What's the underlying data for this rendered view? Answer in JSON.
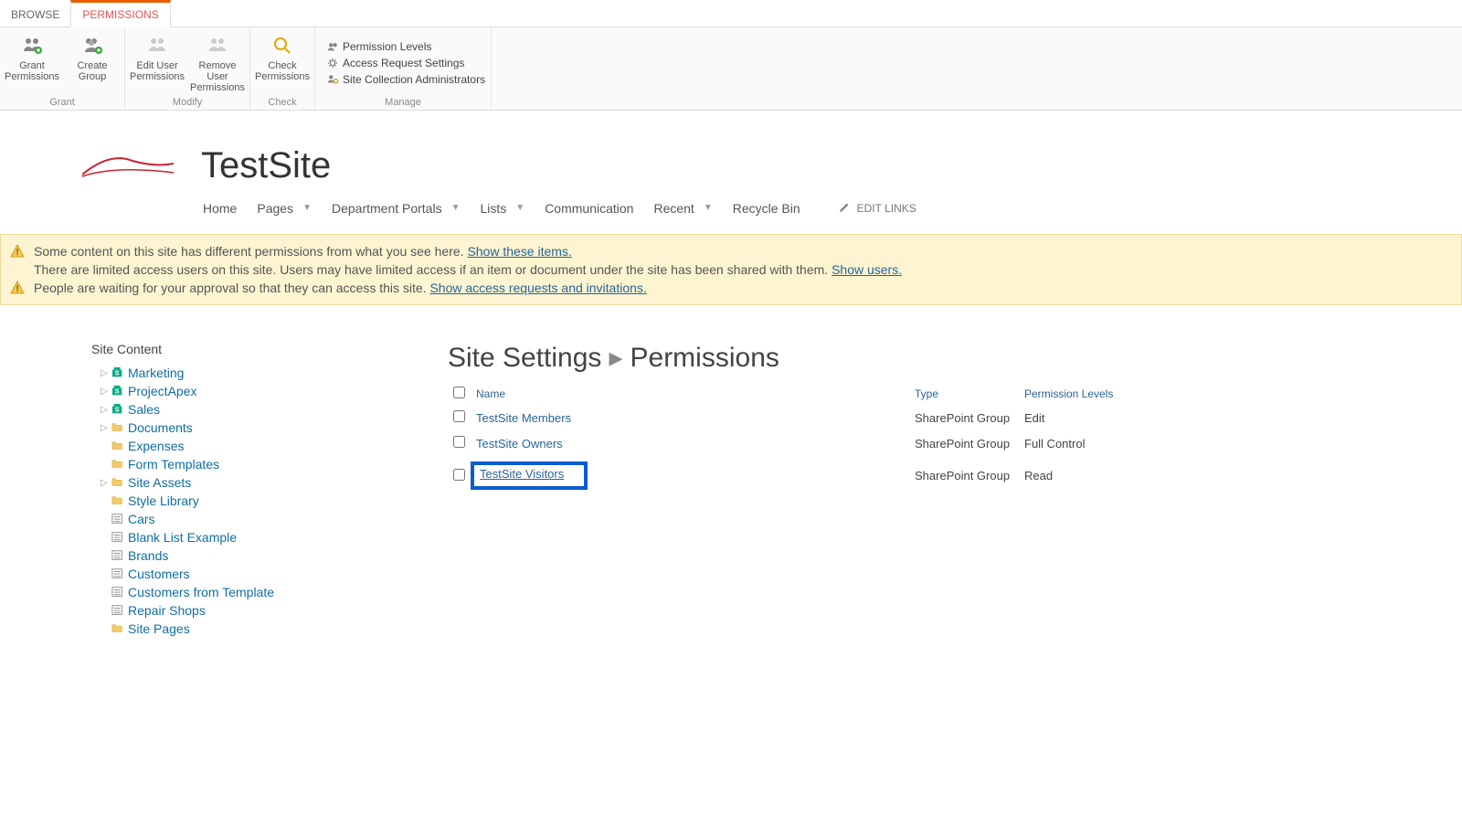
{
  "tabs": {
    "browse": "BROWSE",
    "permissions": "PERMISSIONS"
  },
  "ribbon": {
    "grant": {
      "label": "Grant",
      "buttons": [
        {
          "l1": "Grant",
          "l2": "Permissions",
          "icon": "users-plus"
        },
        {
          "l1": "Create",
          "l2": "Group",
          "icon": "group-plus"
        }
      ]
    },
    "modify": {
      "label": "Modify",
      "buttons": [
        {
          "l1": "Edit User",
          "l2": "Permissions",
          "icon": "users-gray"
        },
        {
          "l1": "Remove User",
          "l2": "Permissions",
          "icon": "users-gray"
        }
      ]
    },
    "check": {
      "label": "Check",
      "buttons": [
        {
          "l1": "Check",
          "l2": "Permissions",
          "icon": "search"
        }
      ]
    },
    "manage": {
      "label": "Manage",
      "links": [
        {
          "text": "Permission Levels",
          "icon": "people-small"
        },
        {
          "text": "Access Request Settings",
          "icon": "gear-small"
        },
        {
          "text": "Site Collection Administrators",
          "icon": "admin-small"
        }
      ]
    }
  },
  "site": {
    "title": "TestSite",
    "nav": [
      {
        "label": "Home",
        "dropdown": false
      },
      {
        "label": "Pages",
        "dropdown": true
      },
      {
        "label": "Department Portals",
        "dropdown": true
      },
      {
        "label": "Lists",
        "dropdown": true
      },
      {
        "label": "Communication",
        "dropdown": false
      },
      {
        "label": "Recent",
        "dropdown": true
      },
      {
        "label": "Recycle Bin",
        "dropdown": false
      }
    ],
    "edit_links": "EDIT LINKS"
  },
  "notifications": [
    {
      "icon": true,
      "text": "Some content on this site has different permissions from what you see here.",
      "link": "Show these items."
    },
    {
      "icon": false,
      "text": "There are limited access users on this site. Users may have limited access if an item or document under the site has been shared with them.",
      "link": "Show users."
    },
    {
      "icon": true,
      "text": "People are waiting for your approval so that they can access this site.",
      "link": "Show access requests and invitations."
    }
  ],
  "sidebar": {
    "title": "Site Content",
    "items": [
      {
        "label": "Marketing",
        "icon": "site",
        "exp": true
      },
      {
        "label": "ProjectApex",
        "icon": "site",
        "exp": true
      },
      {
        "label": "Sales",
        "icon": "site",
        "exp": true
      },
      {
        "label": "Documents",
        "icon": "folder",
        "exp": true
      },
      {
        "label": "Expenses",
        "icon": "folder",
        "exp": false
      },
      {
        "label": "Form Templates",
        "icon": "folder",
        "exp": false
      },
      {
        "label": "Site Assets",
        "icon": "folder",
        "exp": true
      },
      {
        "label": "Style Library",
        "icon": "folder",
        "exp": false
      },
      {
        "label": "Cars",
        "icon": "list",
        "exp": false
      },
      {
        "label": "Blank List Example",
        "icon": "list",
        "exp": false
      },
      {
        "label": "Brands",
        "icon": "list",
        "exp": false
      },
      {
        "label": "Customers",
        "icon": "list",
        "exp": false
      },
      {
        "label": "Customers from Template",
        "icon": "list",
        "exp": false
      },
      {
        "label": "Repair Shops",
        "icon": "list",
        "exp": false
      },
      {
        "label": "Site Pages",
        "icon": "folder",
        "exp": false
      }
    ]
  },
  "content": {
    "breadcrumb_a": "Site Settings",
    "breadcrumb_b": "Permissions",
    "columns": {
      "name": "Name",
      "type": "Type",
      "perm": "Permission Levels"
    },
    "rows": [
      {
        "name": "TestSite Members",
        "type": "SharePoint Group",
        "perm": "Edit",
        "highlight": false
      },
      {
        "name": "TestSite Owners",
        "type": "SharePoint Group",
        "perm": "Full Control",
        "highlight": false
      },
      {
        "name": "TestSite Visitors",
        "type": "SharePoint Group",
        "perm": "Read",
        "highlight": true
      }
    ]
  }
}
